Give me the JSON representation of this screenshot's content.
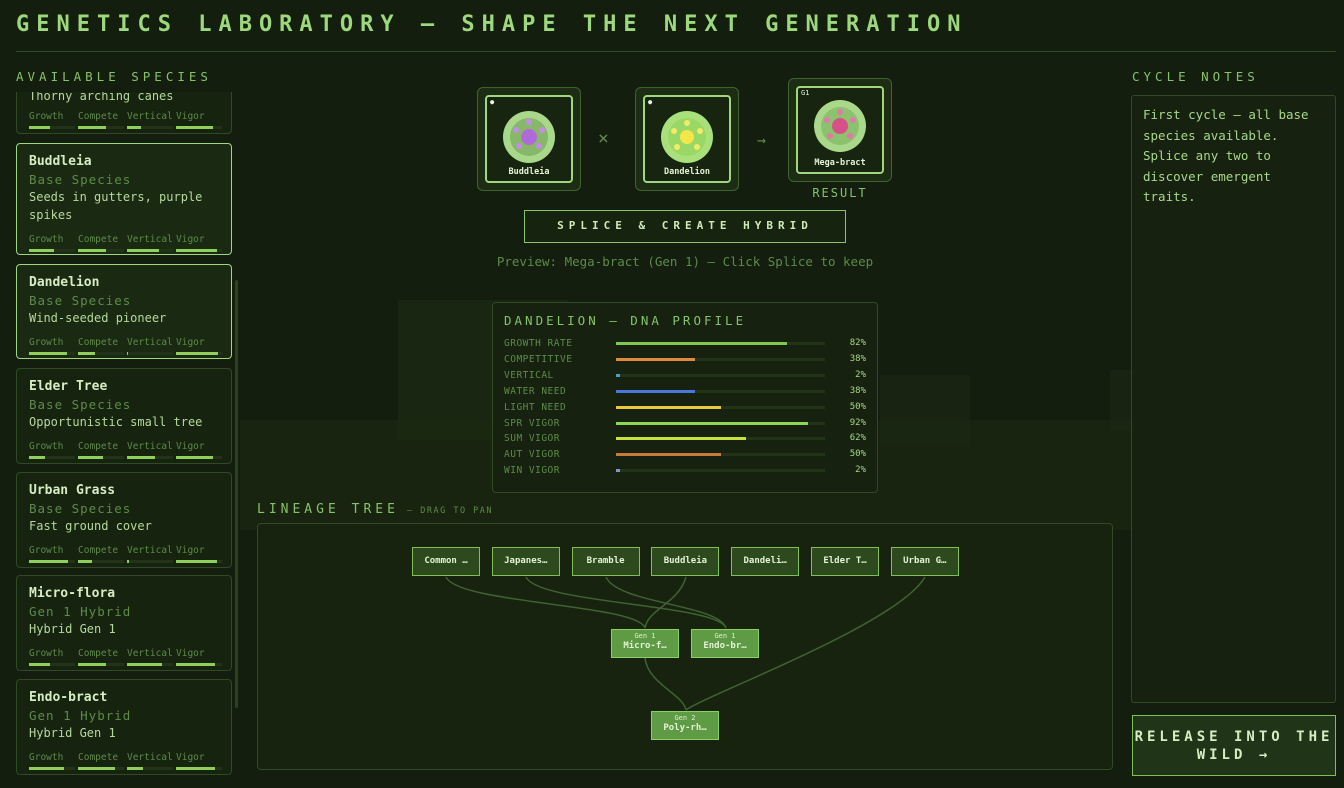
{
  "title": "GENETICS LABORATORY — SHAPE THE NEXT GENERATION",
  "available_species_label": "AVAILABLE SPECIES",
  "cycle_notes_label": "CYCLE NOTES",
  "stat_labels": [
    "Growth",
    "Compete",
    "Vertical",
    "Vigor"
  ],
  "species": [
    {
      "name": "",
      "type": "",
      "desc": "Thorny arching canes",
      "stats": [
        0.45,
        0.6,
        0.3,
        0.8
      ],
      "selected": false
    },
    {
      "name": "Buddleia",
      "type": "Base Species",
      "desc": "Seeds in gutters, purple spikes",
      "stats": [
        0.55,
        0.6,
        0.7,
        0.9
      ],
      "selected": true
    },
    {
      "name": "Dandelion",
      "type": "Base Species",
      "desc": "Wind-seeded pioneer",
      "stats": [
        0.82,
        0.38,
        0.02,
        0.92
      ],
      "selected": true
    },
    {
      "name": "Elder Tree",
      "type": "Base Species",
      "desc": "Opportunistic small tree",
      "stats": [
        0.35,
        0.55,
        0.6,
        0.8
      ],
      "selected": false
    },
    {
      "name": "Urban Grass",
      "type": "Base Species",
      "desc": "Fast ground cover",
      "stats": [
        0.85,
        0.3,
        0.05,
        0.9
      ],
      "selected": false
    },
    {
      "name": "Micro-flora",
      "type": "Gen 1 Hybrid",
      "desc": "Hybrid Gen 1",
      "stats": [
        0.45,
        0.6,
        0.75,
        0.85
      ],
      "selected": false
    },
    {
      "name": "Endo-bract",
      "type": "Gen 1 Hybrid",
      "desc": "Hybrid Gen 1",
      "stats": [
        0.75,
        0.8,
        0.35,
        0.85
      ],
      "selected": false
    }
  ],
  "splice": {
    "parent_a": "Buddleia",
    "operator": "×",
    "parent_b": "Dandelion",
    "arrow": "→",
    "result": "Mega-bract",
    "result_gen_tag": "G1",
    "result_label": "RESULT",
    "button_label": "SPLICE & CREATE HYBRID",
    "preview": "Preview: Mega-bract (Gen 1) — Click Splice to keep"
  },
  "dna": {
    "title": "DANDELION — DNA PROFILE",
    "rows": [
      {
        "label": "GROWTH RATE",
        "value": 82,
        "text": "82%",
        "color": "#7ec850"
      },
      {
        "label": "COMPETITIVE",
        "value": 38,
        "text": "38%",
        "color": "#e08a3c"
      },
      {
        "label": "VERTICAL",
        "value": 2,
        "text": "2%",
        "color": "#4aa0c8"
      },
      {
        "label": "WATER NEED",
        "value": 38,
        "text": "38%",
        "color": "#4a78d8"
      },
      {
        "label": "LIGHT NEED",
        "value": 50,
        "text": "50%",
        "color": "#e8c83c"
      },
      {
        "label": "SPR VIGOR",
        "value": 92,
        "text": "92%",
        "color": "#8cd850"
      },
      {
        "label": "SUM VIGOR",
        "value": 62,
        "text": "62%",
        "color": "#c8e03c"
      },
      {
        "label": "AUT VIGOR",
        "value": 50,
        "text": "50%",
        "color": "#c87a3c"
      },
      {
        "label": "WIN VIGOR",
        "value": 2,
        "text": "2%",
        "color": "#8a90d8"
      }
    ]
  },
  "lineage": {
    "title": "LINEAGE TREE",
    "subtitle": "— DRAG TO PAN",
    "gen0": [
      "Common …",
      "Japanes…",
      "Bramble",
      "Buddleia",
      "Dandeli…",
      "Elder T…",
      "Urban G…"
    ],
    "gen1": [
      {
        "gen": "Gen 1",
        "name": "Micro-f…"
      },
      {
        "gen": "Gen 1",
        "name": "Endo-br…"
      }
    ],
    "gen2": [
      {
        "gen": "Gen 2",
        "name": "Poly-rh…"
      }
    ]
  },
  "cycle_notes": "First cycle — all base species available. Splice any two to discover emergent traits.",
  "release_button": "RELEASE INTO THE WILD →",
  "colors": {
    "background": "#141e0f",
    "accent": "#9ed87c",
    "panel": "#16230f",
    "border": "#2f4a25"
  }
}
